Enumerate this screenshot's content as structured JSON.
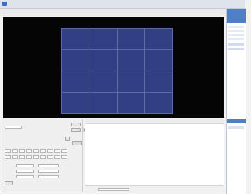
{
  "window": {
    "title": ""
  },
  "menu": {
    "items": [
      "",
      "",
      "",
      "",
      ""
    ]
  },
  "viewer": {
    "cells": [
      "",
      "",
      "",
      "",
      "",
      "",
      "",
      "",
      "",
      "",
      "",
      "",
      "",
      "",
      "",
      ""
    ]
  },
  "sidebar": {
    "header": "",
    "tree": [
      "",
      "",
      "",
      "",
      "",
      "",
      ""
    ],
    "bottom_header": ""
  },
  "controls": {
    "labels": [
      "",
      "",
      "",
      "",
      ""
    ],
    "tabs": [
      "",
      "",
      ""
    ],
    "keys": [
      "",
      "",
      "",
      "",
      "",
      "",
      "",
      "",
      "",
      "",
      "",
      "",
      "",
      "",
      "",
      "",
      "",
      ""
    ],
    "fields": [
      "",
      "",
      "",
      ""
    ]
  },
  "log": {
    "columns": [
      "",
      "",
      "",
      ""
    ],
    "footer": ""
  },
  "colors": {
    "viewer_bg": "#050505",
    "cell_bg": "#333f84",
    "sidebar_accent": "#4f80c6"
  }
}
